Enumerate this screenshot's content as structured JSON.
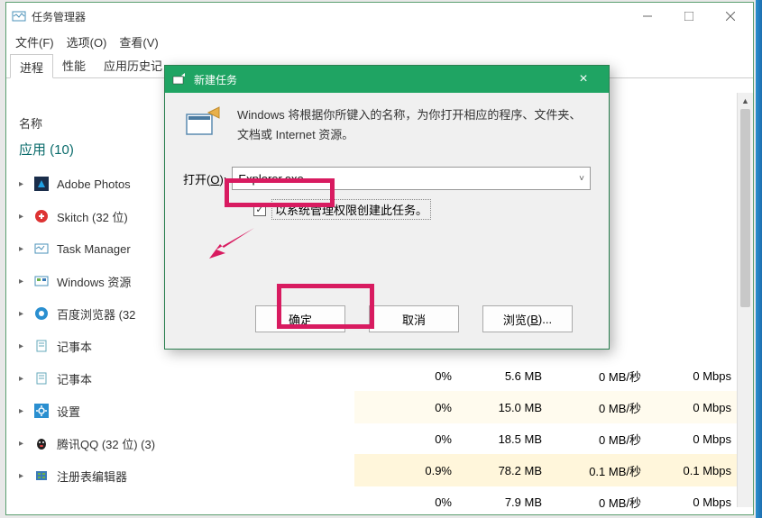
{
  "window": {
    "title": "任务管理器",
    "min": "–",
    "max": "□",
    "close": "×"
  },
  "menu": {
    "file": "文件(F)",
    "options": "选项(O)",
    "view": "查看(V)"
  },
  "tabs": {
    "t0": "进程",
    "t1": "性能",
    "t2": "应用历史记"
  },
  "columns": {
    "name": "名称"
  },
  "group": {
    "apps": "应用 (10)"
  },
  "procs": [
    {
      "name": "Adobe Photos"
    },
    {
      "name": "Skitch (32 位)"
    },
    {
      "name": "Task Manager"
    },
    {
      "name": "Windows 资源"
    },
    {
      "name": "百度浏览器 (32"
    },
    {
      "name": "记事本"
    },
    {
      "name": "记事本"
    },
    {
      "name": "设置"
    },
    {
      "name": "腾讯QQ (32 位) (3)"
    },
    {
      "name": "注册表编辑器"
    }
  ],
  "rows": [
    {
      "cpu": "0%",
      "mem": "5.6 MB",
      "disk": "0 MB/秒",
      "net": "0 Mbps"
    },
    {
      "cpu": "0%",
      "mem": "15.0 MB",
      "disk": "0 MB/秒",
      "net": "0 Mbps"
    },
    {
      "cpu": "0%",
      "mem": "18.5 MB",
      "disk": "0 MB/秒",
      "net": "0 Mbps"
    },
    {
      "cpu": "0.9%",
      "mem": "78.2 MB",
      "disk": "0.1 MB/秒",
      "net": "0.1 Mbps"
    },
    {
      "cpu": "0%",
      "mem": "7.9 MB",
      "disk": "0 MB/秒",
      "net": "0 Mbps"
    }
  ],
  "dialog": {
    "title": "新建任务",
    "desc": "Windows 将根据你所键入的名称，为你打开相应的程序、文件夹、文档或 Internet 资源。",
    "open_label_pre": "打开(",
    "open_label_u": "O",
    "open_label_post": "):",
    "value": "Explorer.exe",
    "checkbox": "以系统管理权限创建此任务。",
    "ok": "确定",
    "cancel": "取消",
    "browse_pre": "浏览(",
    "browse_u": "B",
    "browse_post": ")...",
    "check": "✓",
    "close": "×",
    "chev": "˅"
  }
}
